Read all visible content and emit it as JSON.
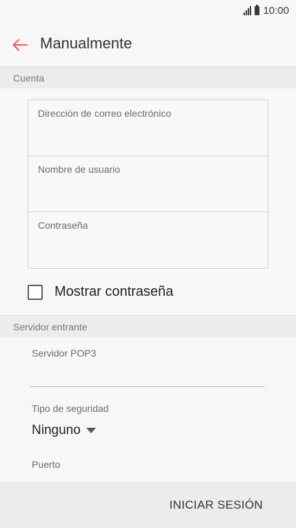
{
  "status_bar": {
    "time": "10:00",
    "icons": [
      "signal-icon",
      "battery-icon"
    ]
  },
  "app_bar": {
    "back_icon": "arrow-left-icon",
    "title": "Manualmente"
  },
  "account_section": {
    "header": "Cuenta",
    "fields": [
      {
        "label": "Dirección de correo electrónico",
        "value": ""
      },
      {
        "label": "Nombre de usuario",
        "value": ""
      },
      {
        "label": "Contraseña",
        "value": ""
      }
    ],
    "show_password": {
      "label": "Mostrar contraseña",
      "checked": false
    }
  },
  "incoming_section": {
    "header": "Servidor entrante",
    "server": {
      "label": "Servidor POP3",
      "value": ""
    },
    "security": {
      "label": "Tipo de seguridad",
      "value": "Ninguno"
    },
    "port": {
      "label": "Puerto"
    }
  },
  "actions": {
    "signin_label": "INICIAR SESIÓN"
  },
  "colors": {
    "accent": "#e8624a",
    "background": "#f7f7f7",
    "section_bg": "#ececec"
  }
}
